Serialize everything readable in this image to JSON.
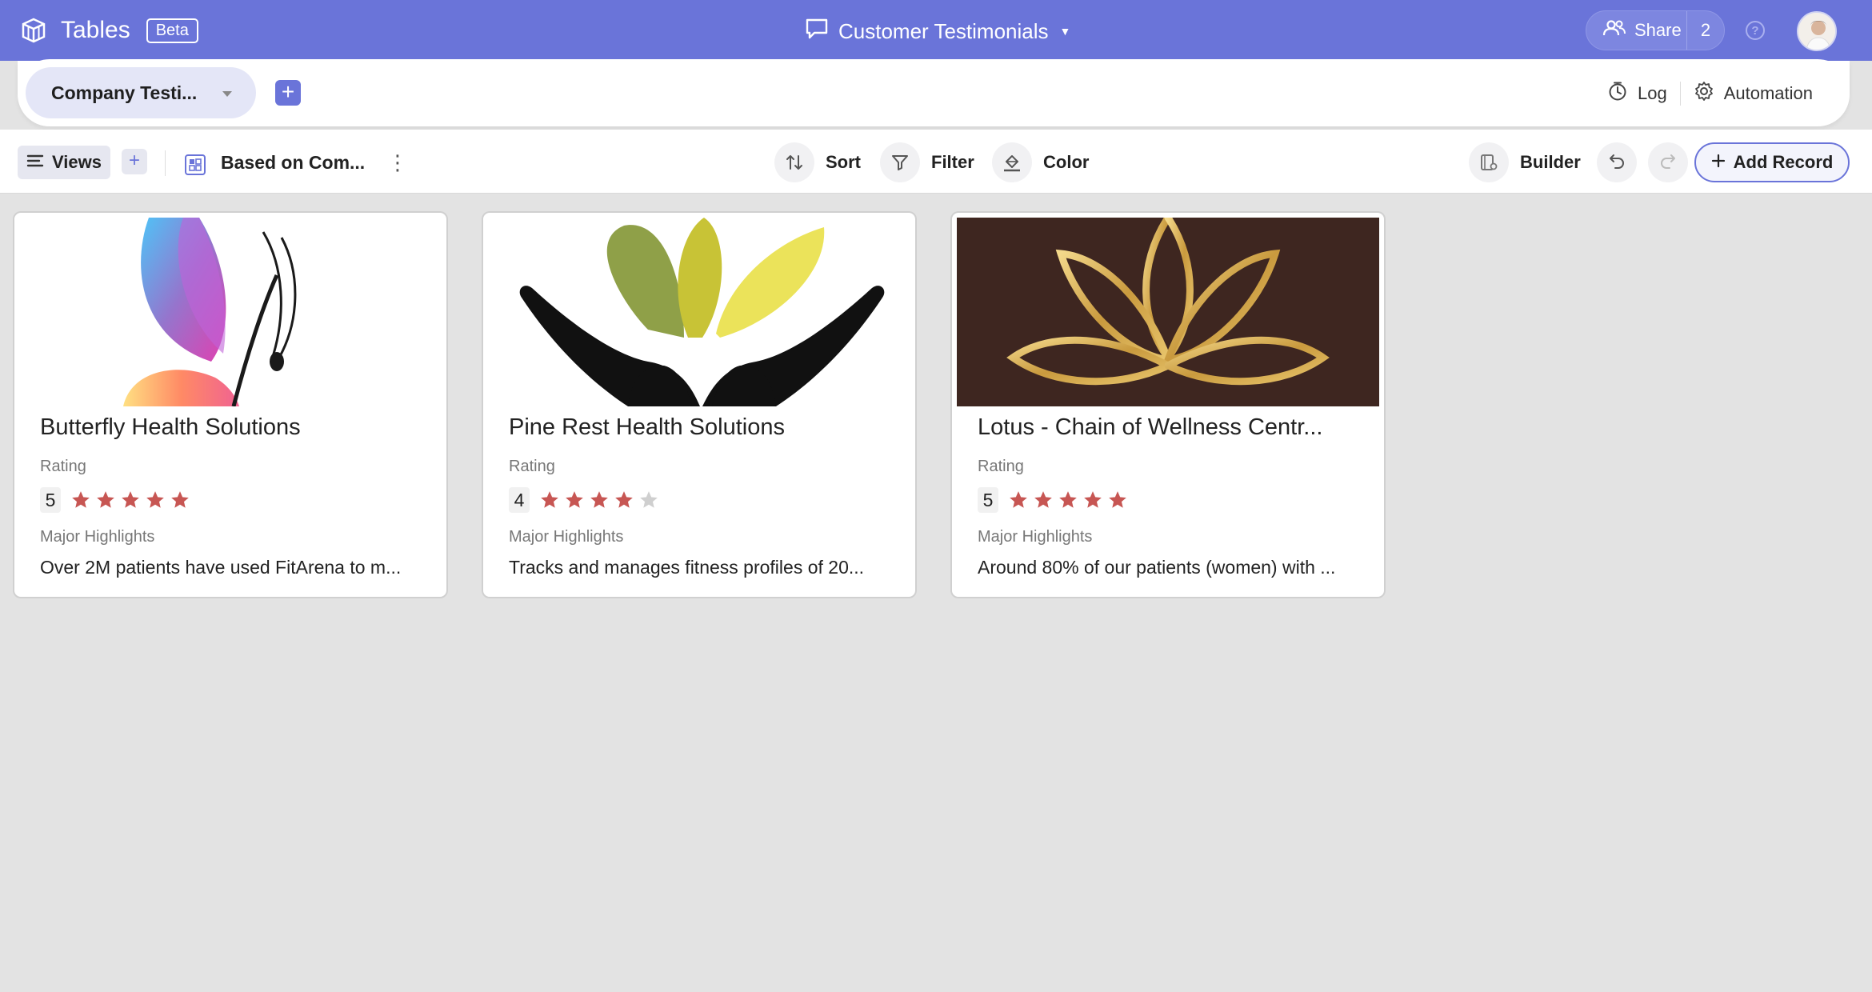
{
  "app": {
    "name": "Tables",
    "badge": "Beta"
  },
  "document": {
    "title": "Customer Testimonials"
  },
  "share": {
    "label": "Share",
    "count": "2"
  },
  "table_tab": {
    "label": "Company Testi..."
  },
  "tab_actions": {
    "log": "Log",
    "automation": "Automation"
  },
  "toolbar": {
    "views": "Views",
    "view_name": "Based on Com...",
    "sort": "Sort",
    "filter": "Filter",
    "color": "Color",
    "builder": "Builder",
    "add_record": "Add Record"
  },
  "colors": {
    "brand": "#6a74d9",
    "star_on": "#c75653",
    "star_off": "#cfcfcf"
  },
  "cards": [
    {
      "title": "Butterfly Health Solutions",
      "rating_label": "Rating",
      "rating": "5",
      "highlights_label": "Major Highlights",
      "highlights": "Over 2M patients have used FitArena to m..."
    },
    {
      "title": "Pine Rest Health Solutions",
      "rating_label": "Rating",
      "rating": "4",
      "highlights_label": "Major Highlights",
      "highlights": "Tracks and manages fitness profiles of 20..."
    },
    {
      "title": "Lotus - Chain of Wellness Centr...",
      "rating_label": "Rating",
      "rating": "5",
      "highlights_label": "Major Highlights",
      "highlights": "Around 80% of our patients (women) with ..."
    }
  ]
}
